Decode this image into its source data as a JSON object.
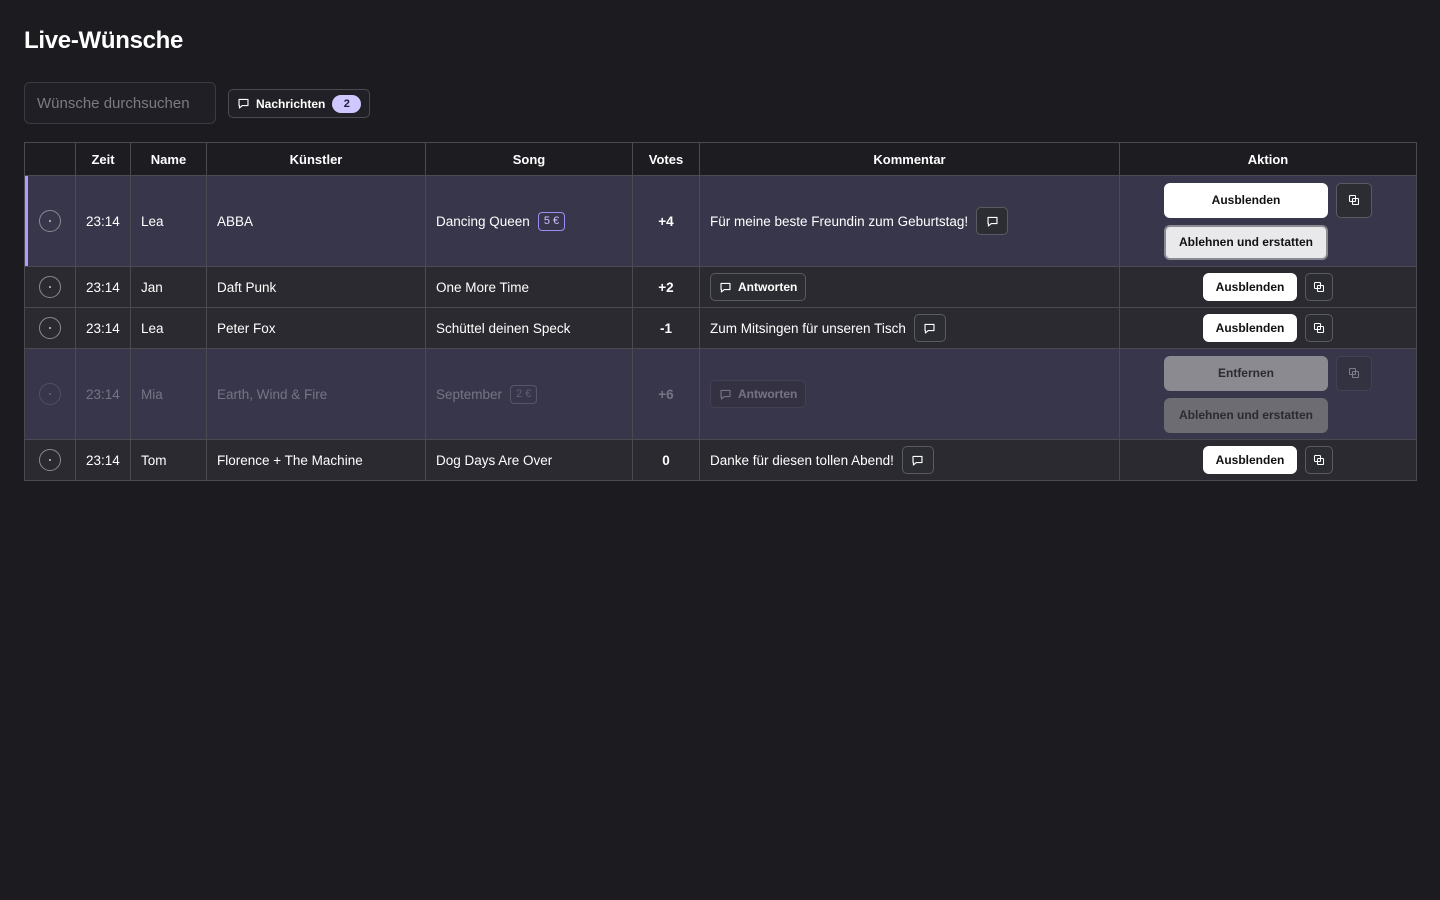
{
  "page": {
    "title": "Live-Wünsche"
  },
  "search": {
    "placeholder": "Wünsche durchsuchen"
  },
  "messages": {
    "label": "Nachrichten",
    "count": "2"
  },
  "table": {
    "headers": [
      "",
      "Zeit",
      "Name",
      "Künstler",
      "Song",
      "Votes",
      "Kommentar",
      "Aktion"
    ]
  },
  "rows": [
    {
      "time": "23:14",
      "name": "Lea",
      "artist": "ABBA",
      "song": "Dancing Queen",
      "price": "5 €",
      "votes": "+4",
      "comment": "Für meine beste Freundin zum Geburtstag!",
      "primary_action": "Ausblenden",
      "secondary_action": "Ablehnen und erstatten"
    },
    {
      "time": "23:14",
      "name": "Jan",
      "artist": "Daft Punk",
      "song": "One More Time",
      "votes": "+2",
      "reply_label": "Antworten",
      "primary_action": "Ausblenden"
    },
    {
      "time": "23:14",
      "name": "Lea",
      "artist": "Peter Fox",
      "song": "Schüttel deinen Speck",
      "votes": "-1",
      "comment": "Zum Mitsingen für unseren Tisch",
      "primary_action": "Ausblenden"
    },
    {
      "time": "23:14",
      "name": "Mia",
      "artist": "Earth, Wind & Fire",
      "song": "September",
      "price": "2 €",
      "votes": "+6",
      "reply_label": "Antworten",
      "primary_action": "Entfernen",
      "secondary_action": "Ablehnen und erstatten"
    },
    {
      "time": "23:14",
      "name": "Tom",
      "artist": "Florence + The Machine",
      "song": "Dog Days Are Over",
      "votes": "0",
      "comment": "Danke für diesen tollen Abend!",
      "primary_action": "Ausblenden"
    }
  ],
  "icons": {
    "message": "message-square-icon",
    "copy": "copy-icon",
    "status": "status-circle-icon"
  },
  "colors": {
    "background": "#1b1b20",
    "accent": "#b09bff",
    "badge": "#cfc8ff"
  }
}
